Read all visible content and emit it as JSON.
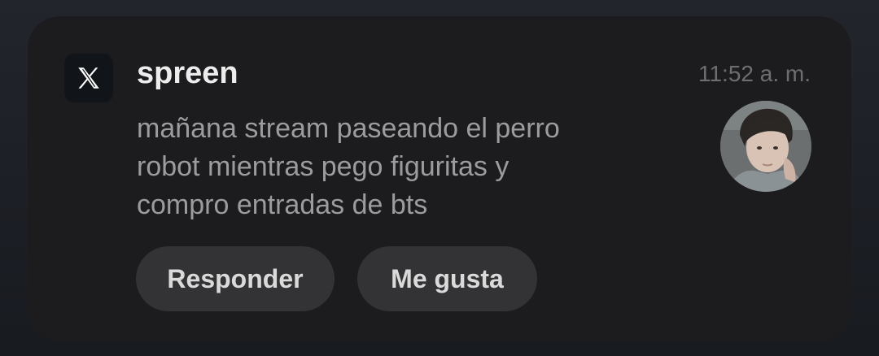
{
  "notification": {
    "app_icon": "x-logo-icon",
    "sender": "spreen",
    "time": "11:52 a. m.",
    "message_lines": [
      "mañana stream paseando el perro",
      "robot mientras pego figuritas y",
      "compro entradas de bts"
    ],
    "avatar": "profile-photo",
    "actions": {
      "reply_label": "Responder",
      "like_label": "Me gusta"
    }
  },
  "colors": {
    "card_background": "#1c1c1e",
    "button_background": "#333335",
    "sender_text": "#ececec",
    "message_text": "#9c9c9e",
    "time_text": "#6e6e70"
  }
}
